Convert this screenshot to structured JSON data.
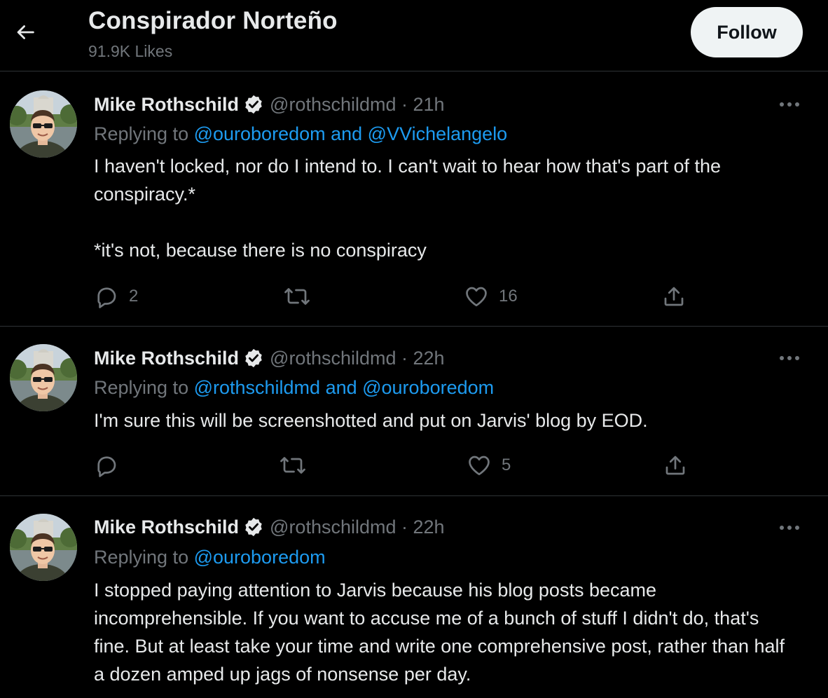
{
  "header": {
    "title": "Conspirador Norteño",
    "subtitle": "91.9K Likes",
    "follow_label": "Follow"
  },
  "tweets": [
    {
      "name": "Mike Rothschild",
      "handle_time": "@rothschildmd · 21h",
      "replying_prefix": "Replying to ",
      "replying_links": "@ouroboredom and @VVichelangelo",
      "body": [
        "I haven't locked, nor do I intend to. I can't wait to hear how that's part of the conspiracy.*",
        "*it's not, because there is no conspiracy"
      ],
      "reply_count": "2",
      "retweet_count": "",
      "like_count": "16"
    },
    {
      "name": "Mike Rothschild",
      "handle_time": "@rothschildmd · 22h",
      "replying_prefix": "Replying to ",
      "replying_links": "@rothschildmd and @ouroboredom",
      "body": [
        "I'm sure this will be screenshotted and put on Jarvis' blog by EOD."
      ],
      "reply_count": "",
      "retweet_count": "",
      "like_count": "5"
    },
    {
      "name": "Mike Rothschild",
      "handle_time": "@rothschildmd · 22h",
      "replying_prefix": "Replying to ",
      "replying_links": "@ouroboredom",
      "body": [
        "I stopped paying attention to Jarvis because his blog posts became incomprehensible. If you want to accuse me of a bunch of stuff I didn't do, that's fine. But at least take your time and write one comprehensive post, rather than half a dozen amped up jags of nonsense per day."
      ]
    }
  ],
  "icons": {
    "back": "arrow-left-icon",
    "verified": "verified-badge-icon",
    "more": "more-icon",
    "reply": "reply-icon",
    "retweet": "retweet-icon",
    "like": "heart-icon",
    "share": "share-icon"
  },
  "colors": {
    "background": "#000000",
    "text": "#e7e9ea",
    "secondary": "#71767b",
    "link": "#1d9bf0",
    "follow_bg": "#eff3f4"
  }
}
